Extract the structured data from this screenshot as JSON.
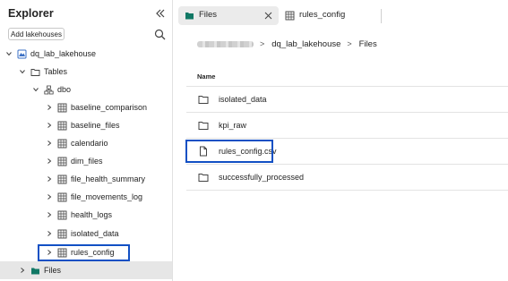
{
  "explorer": {
    "title": "Explorer",
    "add_button": "Add lakehouses",
    "tree": {
      "lakehouse": "dq_lab_lakehouse",
      "tables_folder": "Tables",
      "schema": "dbo",
      "tables": [
        "baseline_comparison",
        "baseline_files",
        "calendario",
        "dim_files",
        "file_health_summary",
        "file_movements_log",
        "health_logs",
        "isolated_data",
        "rules_config"
      ],
      "files_folder": "Files"
    }
  },
  "tabs": [
    {
      "label": "Files",
      "active": true
    },
    {
      "label": "rules_config",
      "active": false
    }
  ],
  "breadcrumb": {
    "items": [
      "dq_lab_lakehouse",
      "Files"
    ]
  },
  "file_list": {
    "column_name": "Name",
    "items": [
      {
        "name": "isolated_data",
        "type": "folder"
      },
      {
        "name": "kpi_raw",
        "type": "folder"
      },
      {
        "name": "rules_config.csv",
        "type": "file"
      },
      {
        "name": "successfully_processed",
        "type": "folder"
      }
    ]
  },
  "colors": {
    "highlight": "#1250c4",
    "files_folder_green": "#117865",
    "selected_bg": "#e6e6e6"
  },
  "icons": {
    "collapse": "double-chevron-left",
    "search": "search",
    "lakehouse": "lakehouse",
    "folder": "folder",
    "table": "table-grid",
    "schema": "schema",
    "file": "document",
    "close": "close"
  }
}
